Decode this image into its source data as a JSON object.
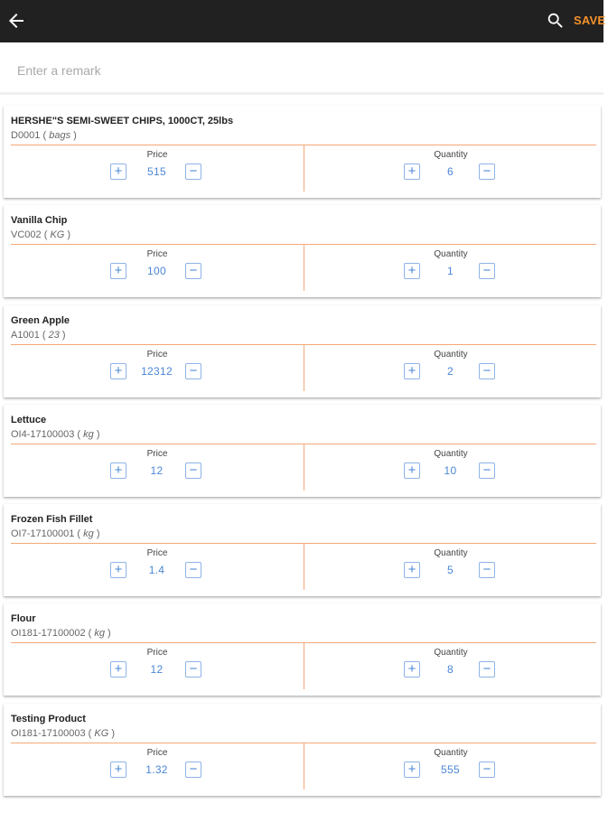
{
  "header": {
    "back_icon": "arrow-left-icon",
    "search_icon": "search-icon",
    "save_label": "SAVE",
    "accent_color": "#f3922b",
    "bar_color": "#212121"
  },
  "remark": {
    "placeholder": "Enter a remark",
    "value": ""
  },
  "labels": {
    "price": "Price",
    "quantity": "Quantity"
  },
  "items": [
    {
      "name": "HERSHE\"S SEMI-SWEET CHIPS, 1000CT, 25lbs",
      "code": "D0001",
      "unit": "bags",
      "price": "515",
      "quantity": "6"
    },
    {
      "name": "Vanilla Chip",
      "code": "VC002",
      "unit": "KG",
      "price": "100",
      "quantity": "1"
    },
    {
      "name": "Green Apple",
      "code": "A1001",
      "unit": "23",
      "price": "12312",
      "quantity": "2"
    },
    {
      "name": "Lettuce",
      "code": "OI4-17100003",
      "unit": "kg",
      "price": "12",
      "quantity": "10"
    },
    {
      "name": "Frozen Fish Fillet",
      "code": "OI7-17100001",
      "unit": "kg",
      "price": "1.4",
      "quantity": "5"
    },
    {
      "name": "Flour",
      "code": "OI181-17100002",
      "unit": "kg",
      "price": "12",
      "quantity": "8"
    },
    {
      "name": "Testing Product",
      "code": "OI181-17100003",
      "unit": "KG",
      "price": "1.32",
      "quantity": "555"
    }
  ]
}
